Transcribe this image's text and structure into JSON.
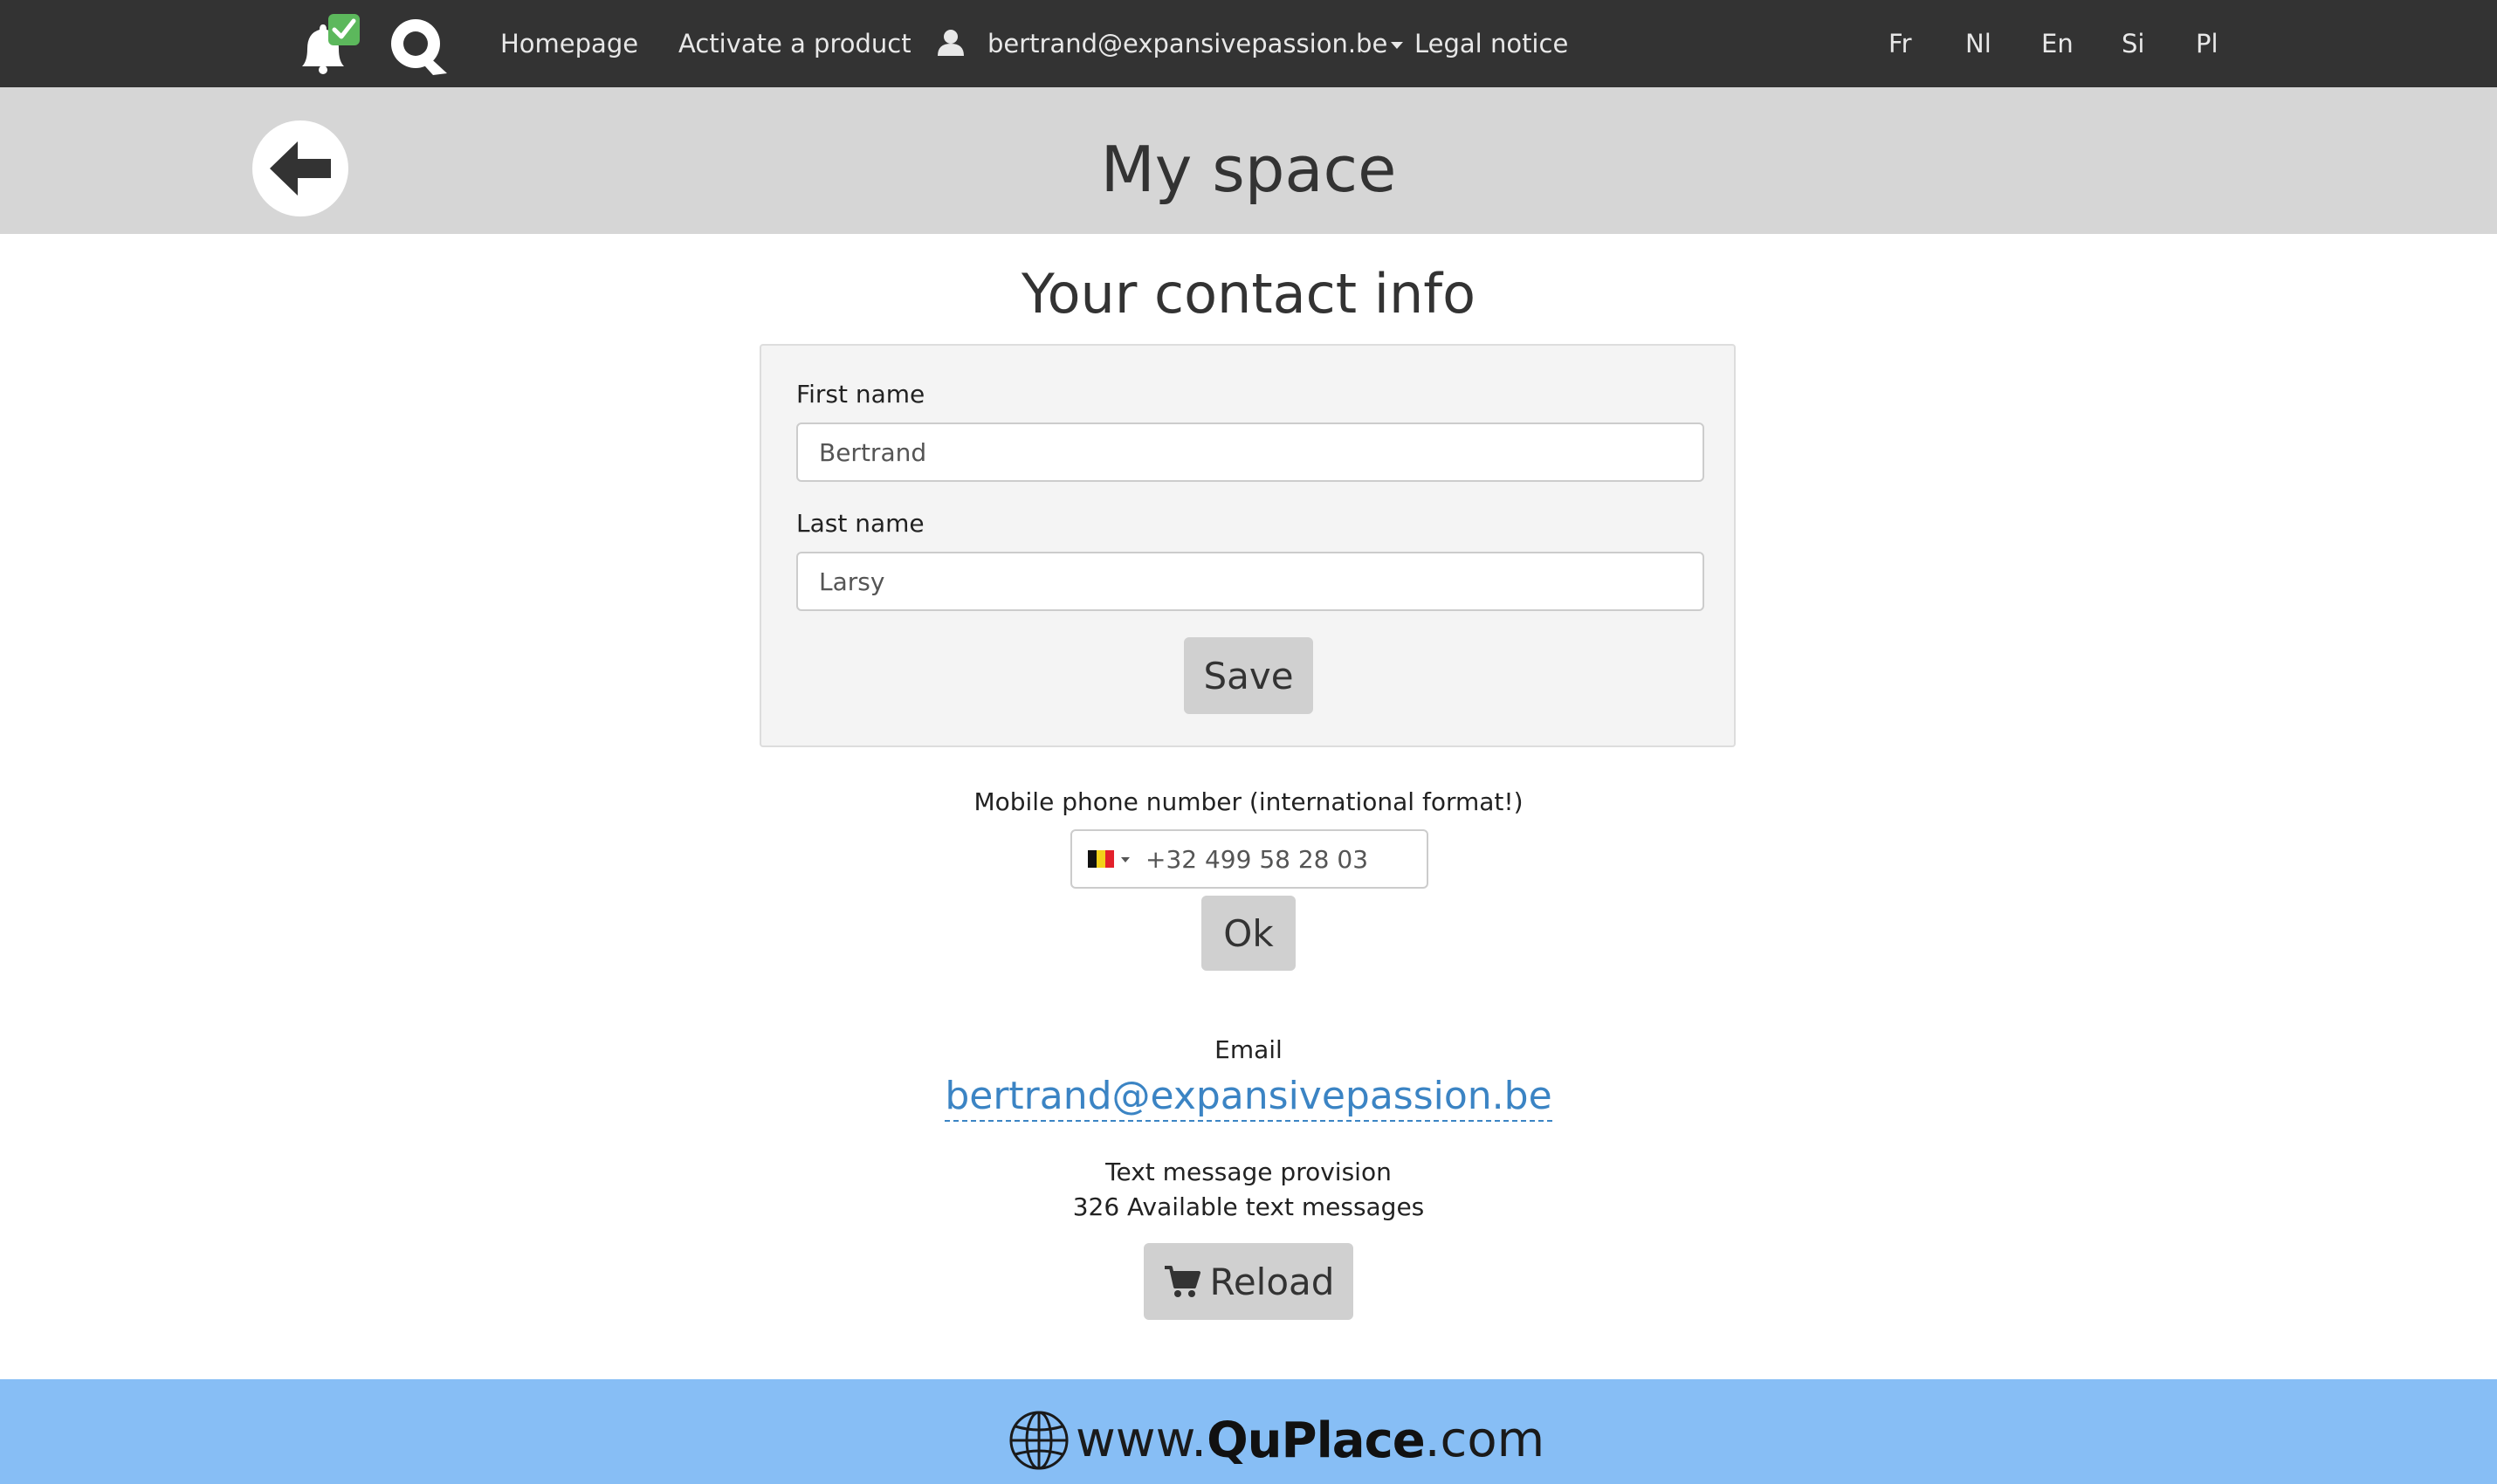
{
  "nav": {
    "links": {
      "homepage": "Homepage",
      "activate": "Activate a product",
      "user": "bertrand@expansivepassion.be",
      "legal": "Legal notice"
    },
    "languages": [
      "Fr",
      "Nl",
      "En",
      "Si",
      "Pl"
    ]
  },
  "header": {
    "title": "My space",
    "back_icon": "arrow-left-icon"
  },
  "contact": {
    "title": "Your contact info",
    "first_name_label": "First name",
    "first_name_value": "Bertrand",
    "last_name_label": "Last name",
    "last_name_value": "Larsy",
    "save_label": "Save"
  },
  "phone": {
    "label": "Mobile phone number (international format!)",
    "value": "+32 499 58 28 03",
    "country_flag": "belgium-flag-icon",
    "ok_label": "Ok"
  },
  "email": {
    "label": "Email",
    "value": "bertrand@expansivepassion.be"
  },
  "sms": {
    "label": "Text message provision",
    "available": "326 Available text messages",
    "reload_label": "Reload"
  },
  "footer": {
    "prefix": "www.",
    "brand": "QuPlace",
    "suffix": ".com"
  },
  "colors": {
    "navbar": "#333333",
    "header": "#d6d6d6",
    "footer": "#87bef5",
    "link": "#3b84c4",
    "notification_check": "#5cb85c"
  }
}
